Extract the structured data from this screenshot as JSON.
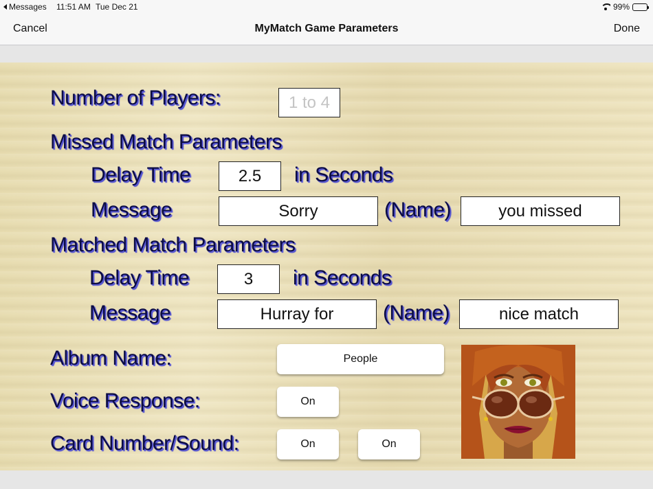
{
  "status_bar": {
    "back_app": "Messages",
    "time": "11:51 AM",
    "date": "Tue Dec 21",
    "battery": "99%",
    "battery_level": 0.99
  },
  "nav": {
    "cancel": "Cancel",
    "title": "MyMatch Game Parameters",
    "done": "Done"
  },
  "form": {
    "players_label": "Number of Players:",
    "players_placeholder": "1 to 4",
    "missed_heading": "Missed Match Parameters",
    "missed_delay_label": "Delay Time",
    "missed_delay_value": "2.5",
    "missed_delay_unit": "in Seconds",
    "missed_message_label": "Message",
    "missed_message_prefix": "Sorry",
    "missed_name_label": "(Name)",
    "missed_message_suffix": "you missed",
    "matched_heading": "Matched Match Parameters",
    "matched_delay_label": "Delay Time",
    "matched_delay_value": "3",
    "matched_delay_unit": "in Seconds",
    "matched_message_label": "Message",
    "matched_message_prefix": "Hurray for",
    "matched_name_label": "(Name)",
    "matched_message_suffix": "nice match",
    "album_label": "Album Name:",
    "album_value": "People",
    "voice_label": "Voice Response:",
    "voice_value": "On",
    "card_label": "Card Number/Sound:",
    "card_number_value": "On",
    "card_sound_value": "On"
  },
  "colors": {
    "label_text": "#0c0c44",
    "label_shadow": "#4a4ad0",
    "wood": "#e9dfb6"
  },
  "icons": [
    "chevron-left-icon",
    "wifi-icon",
    "battery-icon"
  ]
}
